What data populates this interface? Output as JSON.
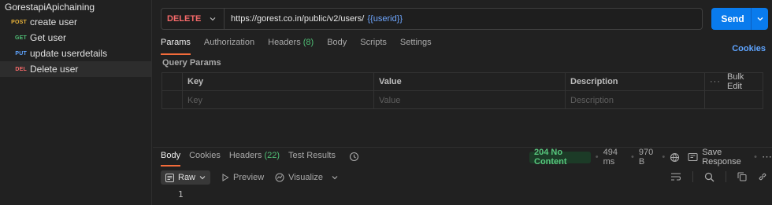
{
  "sidebar": {
    "collection_name": "GorestapiApichaining",
    "requests": [
      {
        "method": "POST",
        "label": "create user",
        "color": "#e8b339"
      },
      {
        "method": "GET",
        "label": "Get user",
        "color": "#4fbf75"
      },
      {
        "method": "PUT",
        "label": "update userdetails",
        "color": "#5ea4ff"
      },
      {
        "method": "DEL",
        "label": "Delete user",
        "color": "#f76a6a"
      }
    ]
  },
  "request": {
    "method": "DELETE",
    "url": "https://gorest.co.in/public/v2/users/",
    "url_variable": "{{userid}}",
    "send_label": "Send"
  },
  "request_tabs": {
    "params": "Params",
    "authorization": "Authorization",
    "headers": "Headers",
    "headers_count": "(8)",
    "body": "Body",
    "scripts": "Scripts",
    "settings": "Settings",
    "cookies": "Cookies"
  },
  "query_params": {
    "title": "Query Params",
    "columns": [
      "Key",
      "Value",
      "Description"
    ],
    "bulk_edit": "Bulk Edit",
    "placeholders": {
      "key": "Key",
      "value": "Value",
      "description": "Description"
    }
  },
  "response": {
    "tabs": {
      "body": "Body",
      "cookies": "Cookies",
      "headers": "Headers",
      "headers_count": "(22)",
      "test_results": "Test Results"
    },
    "status": "204 No Content",
    "time": "494 ms",
    "size": "970 B",
    "save_label": "Save Response",
    "view_mode": "Raw",
    "preview": "Preview",
    "visualize": "Visualize",
    "line_number": "1"
  }
}
